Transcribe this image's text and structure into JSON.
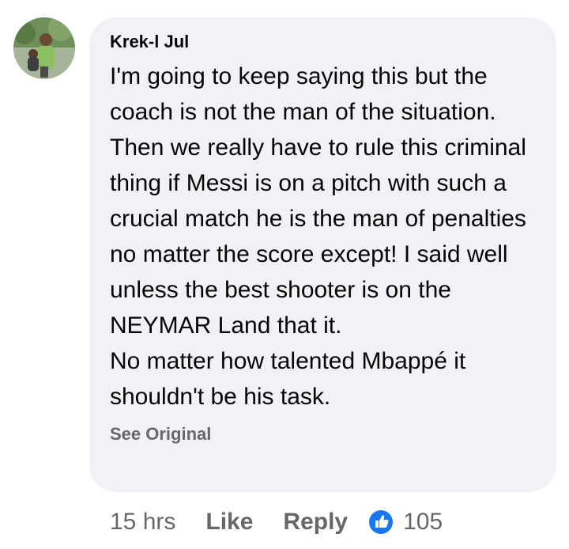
{
  "comment": {
    "author": "Krek-l Jul",
    "paragraphs": [
      "I'm going to keep saying this but the coach is not the man of the situation. Then we really have to rule this criminal thing if Messi is on a pitch with such a crucial match he is the man of penalties no matter the score except! I said well unless the best shooter is on the NEYMAR Land that it.",
      "No matter how talented Mbappé it shouldn't be his task."
    ],
    "see_original": "See Original",
    "time": "15 hrs",
    "like_label": "Like",
    "reply_label": "Reply",
    "reaction_count": "105",
    "reaction_icon": "like-thumb-icon"
  },
  "colors": {
    "bubble_bg": "#f0f2f5",
    "text": "#050505",
    "secondary": "#65676b",
    "like_blue": "#1877f2"
  }
}
